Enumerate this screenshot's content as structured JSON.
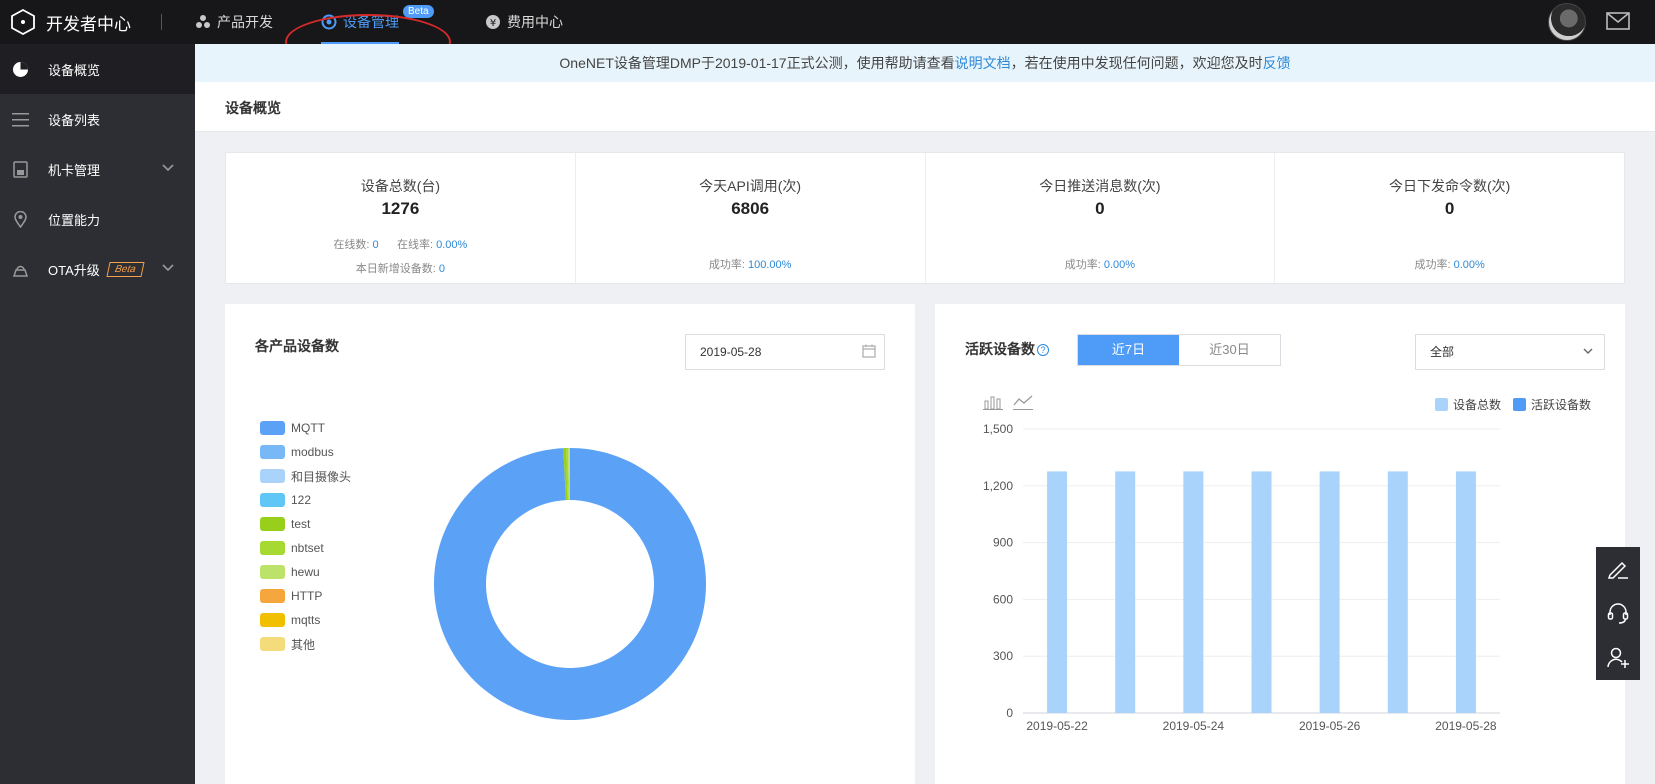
{
  "header": {
    "logo_text": "开发者中心",
    "nav": [
      {
        "label": "产品开发",
        "icon": "product-dev-icon"
      },
      {
        "label": "设备管理",
        "icon": "device-manage-icon",
        "active": true,
        "badge": "Beta"
      },
      {
        "label": "费用中心",
        "icon": "yen-icon"
      }
    ],
    "accent": "#4e9cf7"
  },
  "sidebar": {
    "items": [
      {
        "label": "设备概览",
        "icon": "pie-chart-icon",
        "active": true
      },
      {
        "label": "设备列表",
        "icon": "list-icon"
      },
      {
        "label": "机卡管理",
        "icon": "sim-card-icon",
        "expandable": true
      },
      {
        "label": "位置能力",
        "icon": "location-pin-icon"
      },
      {
        "label": "OTA升级",
        "icon": "ota-upgrade-icon",
        "badge": "Beta",
        "expandable": true
      }
    ]
  },
  "notice": {
    "text1": "OneNET设备管理DMP于2019-01-17正式公测，使用帮助请查看",
    "link1": "说明文档",
    "text2": "，若在使用中发现任何问题，欢迎您及时",
    "link2": "反馈"
  },
  "page": {
    "title": "设备概览"
  },
  "stats": {
    "total": {
      "label": "设备总数(台)",
      "value": "1276",
      "online_label": "在线数:",
      "online": "0",
      "rate_label": "在线率:",
      "rate": "0.00%",
      "new_label": "本日新增设备数:",
      "new": "0"
    },
    "api": {
      "label": "今天API调用(次)",
      "value": "6806",
      "success_label": "成功率:",
      "success": "100.00%"
    },
    "push": {
      "label": "今日推送消息数(次)",
      "value": "0",
      "success_label": "成功率:",
      "success": "0.00%"
    },
    "cmd": {
      "label": "今日下发命令数(次)",
      "value": "0",
      "success_label": "成功率:",
      "success": "0.00%"
    }
  },
  "left_panel": {
    "title": "各产品设备数",
    "date": "2019-05-28",
    "legend": [
      {
        "label": "MQTT",
        "color": "#5ba2f7"
      },
      {
        "label": "modbus",
        "color": "#79b8f7"
      },
      {
        "label": "和目摄像头",
        "color": "#a9d3fb"
      },
      {
        "label": "122",
        "color": "#5fc6f5"
      },
      {
        "label": "test",
        "color": "#97cf1a"
      },
      {
        "label": "nbtset",
        "color": "#a6d932"
      },
      {
        "label": "hewu",
        "color": "#bde26a"
      },
      {
        "label": "HTTP",
        "color": "#f5a73d"
      },
      {
        "label": "mqtts",
        "color": "#f0c000"
      },
      {
        "label": "其他",
        "color": "#f5dc7a"
      }
    ]
  },
  "right_panel": {
    "title": "活跃设备数",
    "info": "?",
    "tabs": [
      "近7日",
      "近30日"
    ],
    "active_tab": 0,
    "select_value": "全部",
    "legend": [
      {
        "label": "设备总数",
        "color": "#a9d3fb"
      },
      {
        "label": "活跃设备数",
        "color": "#4e9cf7"
      }
    ]
  },
  "chart_data": [
    {
      "type": "pie",
      "donut": true,
      "categories": [
        "MQTT",
        "modbus",
        "和目摄像头",
        "122",
        "test",
        "nbtset",
        "hewu",
        "HTTP",
        "mqtts",
        "其他"
      ],
      "values": [
        1266,
        0,
        0,
        0,
        4,
        3,
        3,
        0,
        0,
        0
      ]
    },
    {
      "type": "bar",
      "categories": [
        "2019-05-22",
        "2019-05-23",
        "2019-05-24",
        "2019-05-25",
        "2019-05-26",
        "2019-05-27",
        "2019-05-28"
      ],
      "tick_labels_shown": [
        "2019-05-22",
        "2019-05-24",
        "2019-05-26",
        "2019-05-28"
      ],
      "series": [
        {
          "name": "设备总数",
          "values": [
            1276,
            1276,
            1276,
            1276,
            1276,
            1276,
            1276
          ]
        },
        {
          "name": "活跃设备数",
          "values": [
            0,
            0,
            0,
            0,
            0,
            0,
            0
          ]
        }
      ],
      "ylim": [
        0,
        1500
      ],
      "yticks": [
        0,
        300,
        600,
        900,
        "1,200",
        "1,500"
      ],
      "grid": true,
      "legend": "top-right"
    }
  ]
}
